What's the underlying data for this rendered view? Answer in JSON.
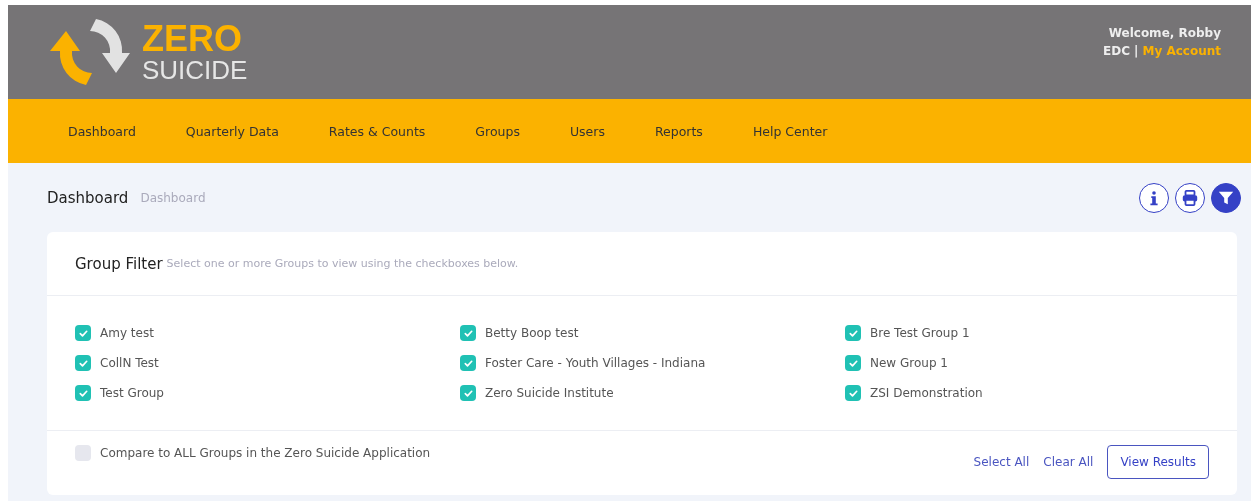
{
  "logo": {
    "line_1": "ZERO",
    "line_2": "SUICIDE"
  },
  "user": {
    "welcome": "Welcome, Robby",
    "org": "EDC",
    "separator": "|",
    "account_link": "My Account"
  },
  "nav": [
    {
      "label": "Dashboard"
    },
    {
      "label": "Quarterly Data"
    },
    {
      "label": "Rates & Counts"
    },
    {
      "label": "Groups"
    },
    {
      "label": "Users"
    },
    {
      "label": "Reports"
    },
    {
      "label": "Help Center"
    }
  ],
  "page": {
    "title": "Dashboard",
    "breadcrumb": "Dashboard"
  },
  "toolbar": [
    {
      "kind": "info",
      "selected": false
    },
    {
      "kind": "print",
      "selected": false
    },
    {
      "kind": "filter",
      "selected": true
    }
  ],
  "group_filter": {
    "title": "Group Filter",
    "hint": "Select one or more Groups to view using the checkboxes below.",
    "groups": [
      {
        "label": "Amy test",
        "checked": true
      },
      {
        "label": "Betty Boop test",
        "checked": true
      },
      {
        "label": "Bre Test Group 1",
        "checked": true
      },
      {
        "label": "CollN Test",
        "checked": true
      },
      {
        "label": "Foster Care - Youth Villages - Indiana",
        "checked": true
      },
      {
        "label": "New Group 1",
        "checked": true
      },
      {
        "label": "Test Group",
        "checked": true
      },
      {
        "label": "Zero Suicide Institute",
        "checked": true
      },
      {
        "label": "ZSI Demonstration",
        "checked": true
      }
    ],
    "compare": {
      "label": "Compare to ALL Groups in the Zero Suicide Application",
      "checked": false
    },
    "select_all": "Select All",
    "clear_all": "Clear All",
    "view_results": "View Results"
  }
}
